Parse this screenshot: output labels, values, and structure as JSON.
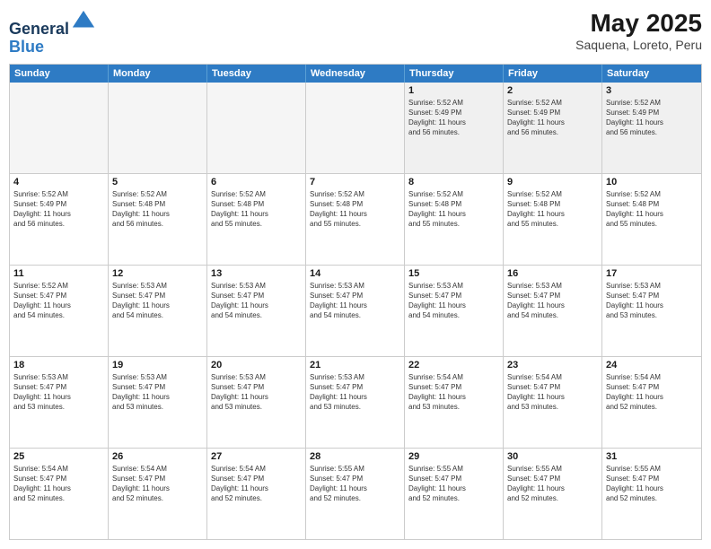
{
  "header": {
    "logo_line1": "General",
    "logo_line2": "Blue",
    "title": "May 2025",
    "subtitle": "Saquena, Loreto, Peru"
  },
  "days_of_week": [
    "Sunday",
    "Monday",
    "Tuesday",
    "Wednesday",
    "Thursday",
    "Friday",
    "Saturday"
  ],
  "weeks": [
    [
      {
        "day": "",
        "info": "",
        "empty": true
      },
      {
        "day": "",
        "info": "",
        "empty": true
      },
      {
        "day": "",
        "info": "",
        "empty": true
      },
      {
        "day": "",
        "info": "",
        "empty": true
      },
      {
        "day": "1",
        "info": "Sunrise: 5:52 AM\nSunset: 5:49 PM\nDaylight: 11 hours\nand 56 minutes."
      },
      {
        "day": "2",
        "info": "Sunrise: 5:52 AM\nSunset: 5:49 PM\nDaylight: 11 hours\nand 56 minutes."
      },
      {
        "day": "3",
        "info": "Sunrise: 5:52 AM\nSunset: 5:49 PM\nDaylight: 11 hours\nand 56 minutes."
      }
    ],
    [
      {
        "day": "4",
        "info": "Sunrise: 5:52 AM\nSunset: 5:49 PM\nDaylight: 11 hours\nand 56 minutes."
      },
      {
        "day": "5",
        "info": "Sunrise: 5:52 AM\nSunset: 5:48 PM\nDaylight: 11 hours\nand 56 minutes."
      },
      {
        "day": "6",
        "info": "Sunrise: 5:52 AM\nSunset: 5:48 PM\nDaylight: 11 hours\nand 55 minutes."
      },
      {
        "day": "7",
        "info": "Sunrise: 5:52 AM\nSunset: 5:48 PM\nDaylight: 11 hours\nand 55 minutes."
      },
      {
        "day": "8",
        "info": "Sunrise: 5:52 AM\nSunset: 5:48 PM\nDaylight: 11 hours\nand 55 minutes."
      },
      {
        "day": "9",
        "info": "Sunrise: 5:52 AM\nSunset: 5:48 PM\nDaylight: 11 hours\nand 55 minutes."
      },
      {
        "day": "10",
        "info": "Sunrise: 5:52 AM\nSunset: 5:48 PM\nDaylight: 11 hours\nand 55 minutes."
      }
    ],
    [
      {
        "day": "11",
        "info": "Sunrise: 5:52 AM\nSunset: 5:47 PM\nDaylight: 11 hours\nand 54 minutes."
      },
      {
        "day": "12",
        "info": "Sunrise: 5:53 AM\nSunset: 5:47 PM\nDaylight: 11 hours\nand 54 minutes."
      },
      {
        "day": "13",
        "info": "Sunrise: 5:53 AM\nSunset: 5:47 PM\nDaylight: 11 hours\nand 54 minutes."
      },
      {
        "day": "14",
        "info": "Sunrise: 5:53 AM\nSunset: 5:47 PM\nDaylight: 11 hours\nand 54 minutes."
      },
      {
        "day": "15",
        "info": "Sunrise: 5:53 AM\nSunset: 5:47 PM\nDaylight: 11 hours\nand 54 minutes."
      },
      {
        "day": "16",
        "info": "Sunrise: 5:53 AM\nSunset: 5:47 PM\nDaylight: 11 hours\nand 54 minutes."
      },
      {
        "day": "17",
        "info": "Sunrise: 5:53 AM\nSunset: 5:47 PM\nDaylight: 11 hours\nand 53 minutes."
      }
    ],
    [
      {
        "day": "18",
        "info": "Sunrise: 5:53 AM\nSunset: 5:47 PM\nDaylight: 11 hours\nand 53 minutes."
      },
      {
        "day": "19",
        "info": "Sunrise: 5:53 AM\nSunset: 5:47 PM\nDaylight: 11 hours\nand 53 minutes."
      },
      {
        "day": "20",
        "info": "Sunrise: 5:53 AM\nSunset: 5:47 PM\nDaylight: 11 hours\nand 53 minutes."
      },
      {
        "day": "21",
        "info": "Sunrise: 5:53 AM\nSunset: 5:47 PM\nDaylight: 11 hours\nand 53 minutes."
      },
      {
        "day": "22",
        "info": "Sunrise: 5:54 AM\nSunset: 5:47 PM\nDaylight: 11 hours\nand 53 minutes."
      },
      {
        "day": "23",
        "info": "Sunrise: 5:54 AM\nSunset: 5:47 PM\nDaylight: 11 hours\nand 53 minutes."
      },
      {
        "day": "24",
        "info": "Sunrise: 5:54 AM\nSunset: 5:47 PM\nDaylight: 11 hours\nand 52 minutes."
      }
    ],
    [
      {
        "day": "25",
        "info": "Sunrise: 5:54 AM\nSunset: 5:47 PM\nDaylight: 11 hours\nand 52 minutes."
      },
      {
        "day": "26",
        "info": "Sunrise: 5:54 AM\nSunset: 5:47 PM\nDaylight: 11 hours\nand 52 minutes."
      },
      {
        "day": "27",
        "info": "Sunrise: 5:54 AM\nSunset: 5:47 PM\nDaylight: 11 hours\nand 52 minutes."
      },
      {
        "day": "28",
        "info": "Sunrise: 5:55 AM\nSunset: 5:47 PM\nDaylight: 11 hours\nand 52 minutes."
      },
      {
        "day": "29",
        "info": "Sunrise: 5:55 AM\nSunset: 5:47 PM\nDaylight: 11 hours\nand 52 minutes."
      },
      {
        "day": "30",
        "info": "Sunrise: 5:55 AM\nSunset: 5:47 PM\nDaylight: 11 hours\nand 52 minutes."
      },
      {
        "day": "31",
        "info": "Sunrise: 5:55 AM\nSunset: 5:47 PM\nDaylight: 11 hours\nand 52 minutes."
      }
    ]
  ]
}
